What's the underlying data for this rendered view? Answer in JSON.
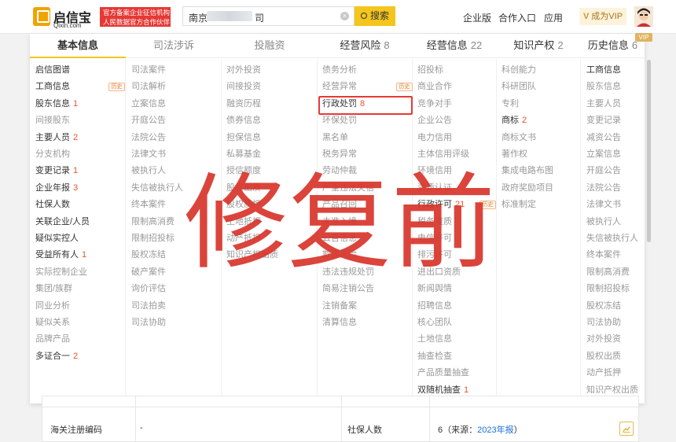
{
  "header": {
    "logo_name": "启信宝",
    "logo_domain": "Qixin.com",
    "tagline_line1": "官方备案企业征信机构",
    "tagline_line2": "人民数据官方合作伙伴",
    "search_value": "南京",
    "search_value_suffix": "司",
    "search_button": "搜索",
    "nav": [
      "企业版",
      "合作入口",
      "应用"
    ],
    "vip_button": "成为VIP",
    "accent_color": "#f4c51c"
  },
  "tabs": [
    {
      "label": "基本信息",
      "count": ""
    },
    {
      "label": "司法涉诉",
      "count": ""
    },
    {
      "label": "投融资",
      "count": ""
    },
    {
      "label": "经营风险",
      "count": "8"
    },
    {
      "label": "经营信息",
      "count": "22"
    },
    {
      "label": "知识产权",
      "count": "2"
    },
    {
      "label": "历史信息",
      "count": "6"
    }
  ],
  "vip_corner": "VIP",
  "hist_badge": "历史",
  "columns": [
    [
      {
        "label": "启信图谱",
        "active": true
      },
      {
        "label": "工商信息",
        "active": true,
        "badge": true
      },
      {
        "label": "股东信息",
        "active": true,
        "count": "1"
      },
      {
        "label": "间接股东",
        "active": false
      },
      {
        "label": "主要人员",
        "active": true,
        "count": "2"
      },
      {
        "label": "分支机构",
        "active": false
      },
      {
        "label": "变更记录",
        "active": true,
        "count": "1"
      },
      {
        "label": "企业年报",
        "active": true,
        "count": "3"
      },
      {
        "label": "社保人数",
        "active": true
      },
      {
        "label": "关联企业/人员",
        "active": true
      },
      {
        "label": "疑似实控人",
        "active": true
      },
      {
        "label": "受益所有人",
        "active": true,
        "count": "1"
      },
      {
        "label": "实际控制企业",
        "active": false
      },
      {
        "label": "集团/族群",
        "active": false
      },
      {
        "label": "同业分析",
        "active": false
      },
      {
        "label": "疑似关系",
        "active": false
      },
      {
        "label": "品牌产品",
        "active": false
      },
      {
        "label": "多证合一",
        "active": true,
        "count": "2"
      }
    ],
    [
      {
        "label": "司法案件"
      },
      {
        "label": "司法解析"
      },
      {
        "label": "立案信息"
      },
      {
        "label": "开庭公告"
      },
      {
        "label": "法院公告"
      },
      {
        "label": "法律文书"
      },
      {
        "label": "被执行人"
      },
      {
        "label": "失信被执行人"
      },
      {
        "label": "终本案件"
      },
      {
        "label": "限制高消费"
      },
      {
        "label": "限制招投标"
      },
      {
        "label": "股权冻结"
      },
      {
        "label": "破产案件"
      },
      {
        "label": "询价评估"
      },
      {
        "label": "司法拍卖"
      },
      {
        "label": "司法协助"
      }
    ],
    [
      {
        "label": "对外投资"
      },
      {
        "label": "间接投资"
      },
      {
        "label": "融资历程"
      },
      {
        "label": "债券信息"
      },
      {
        "label": "担保信息"
      },
      {
        "label": "私募基金"
      },
      {
        "label": "授信额度"
      },
      {
        "label": "股权出质"
      },
      {
        "label": "股权质押"
      },
      {
        "label": "土地抵押"
      },
      {
        "label": "动产抵押"
      },
      {
        "label": "知识产权出质"
      }
    ],
    [
      {
        "label": "债务分析"
      },
      {
        "label": "经营异常",
        "badge": true
      },
      {
        "label": "行政处罚",
        "active": true,
        "count": "8"
      },
      {
        "label": "环保处罚"
      },
      {
        "label": "黑名单"
      },
      {
        "label": "税务异常"
      },
      {
        "label": "劳动仲裁"
      },
      {
        "label": "严重违法失信"
      },
      {
        "label": "产品召回"
      },
      {
        "label": "未准入境"
      },
      {
        "label": "公告信息"
      },
      {
        "label": "欺诈风险"
      },
      {
        "label": "违法违规处罚"
      },
      {
        "label": "简易注销公告"
      },
      {
        "label": "注销备案"
      },
      {
        "label": "清算信息"
      }
    ],
    [
      {
        "label": "招投标"
      },
      {
        "label": "商业合作"
      },
      {
        "label": "竞争对手"
      },
      {
        "label": "企业公告"
      },
      {
        "label": "电力信用"
      },
      {
        "label": "主体信用评级"
      },
      {
        "label": "环境信用"
      },
      {
        "label": "资质认证"
      },
      {
        "label": "行政许可",
        "active": true,
        "count": "21",
        "badge": true
      },
      {
        "label": "税务资质"
      },
      {
        "label": "电信许可"
      },
      {
        "label": "排污许可"
      },
      {
        "label": "进出口资质"
      },
      {
        "label": "新闻舆情"
      },
      {
        "label": "招聘信息"
      },
      {
        "label": "核心团队"
      },
      {
        "label": "土地信息"
      },
      {
        "label": "抽查检查"
      },
      {
        "label": "产品质量抽查"
      },
      {
        "label": "双随机抽查",
        "active": true,
        "count": "1"
      }
    ],
    [
      {
        "label": "科创能力"
      },
      {
        "label": "科研团队"
      },
      {
        "label": "专利"
      },
      {
        "label": "商标",
        "active": true,
        "count": "2"
      },
      {
        "label": "商标文书"
      },
      {
        "label": "著作权"
      },
      {
        "label": "集成电路布图"
      },
      {
        "label": "政府奖励项目"
      },
      {
        "label": "标准制定"
      }
    ],
    [
      {
        "label": "工商信息",
        "active": true
      },
      {
        "label": "股东信息"
      },
      {
        "label": "主要人员"
      },
      {
        "label": "变更记录"
      },
      {
        "label": "减资公告"
      },
      {
        "label": "立案信息"
      },
      {
        "label": "开庭公告"
      },
      {
        "label": "法院公告"
      },
      {
        "label": "法律文书"
      },
      {
        "label": "被执行人"
      },
      {
        "label": "失信被执行人"
      },
      {
        "label": "终本案件"
      },
      {
        "label": "限制高消费"
      },
      {
        "label": "限制招投标"
      },
      {
        "label": "股权冻结"
      },
      {
        "label": "司法协助"
      },
      {
        "label": "对外投资"
      },
      {
        "label": "股权出质"
      },
      {
        "label": "动产抵押"
      },
      {
        "label": "知识产权出质"
      }
    ]
  ],
  "bottom_table": {
    "row_label": "海关注册编码",
    "row_value": "-",
    "social_label": "社保人数",
    "social_value": "6（来源：",
    "social_link": "2023年报",
    "social_close": "）"
  },
  "watermark": "修复前"
}
